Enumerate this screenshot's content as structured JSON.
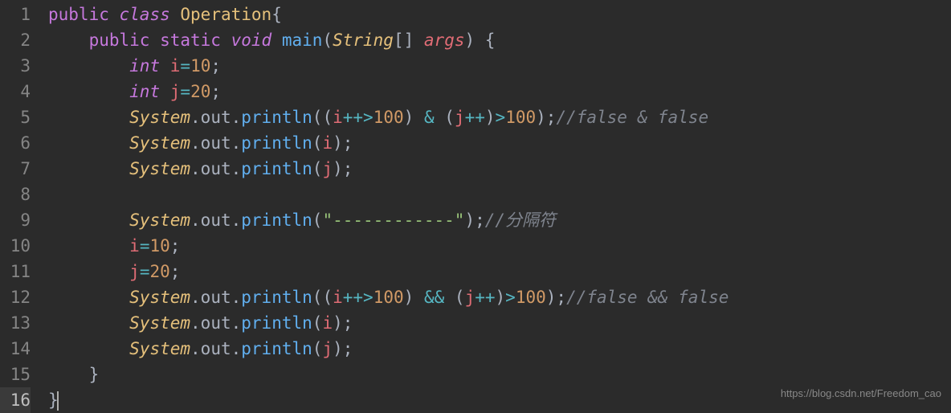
{
  "lineNumbers": [
    "1",
    "2",
    "3",
    "4",
    "5",
    "6",
    "7",
    "8",
    "9",
    "10",
    "11",
    "12",
    "13",
    "14",
    "15",
    "16"
  ],
  "activeLine": 16,
  "tokens": {
    "public": "public",
    "class": "class",
    "static": "static",
    "void": "void",
    "int": "int",
    "Operation": "Operation",
    "main": "main",
    "String": "String",
    "args": "args",
    "System": "System",
    "out": "out",
    "println": "println",
    "i": "i",
    "j": "j",
    "v10": "10",
    "v20": "20",
    "v100": "100",
    "amp": "&",
    "ampamp": "&&",
    "gt": ">",
    "plusplus": "++",
    "eq": "=",
    "semi": ";",
    "lb": "{",
    "rb": "}",
    "lp": "(",
    "rp": ")",
    "lbr": "[",
    "rbr": "]",
    "dot": ".",
    "sp": " ",
    "dashstr": "\"------------\"",
    "c1": "//false & false",
    "c2": "//分隔符",
    "c3": "//false && false"
  },
  "watermark": "https://blog.csdn.net/Freedom_cao",
  "chart_data": {
    "type": "table",
    "title": "Java source code",
    "language": "java",
    "lines": [
      "public class Operation{",
      "    public static void main(String[] args) {",
      "        int i=10;",
      "        int j=20;",
      "        System.out.println((i++>100) & (j++)>100);//false & false",
      "        System.out.println(i);",
      "        System.out.println(j);",
      "",
      "        System.out.println(\"------------\");//分隔符",
      "        i=10;",
      "        j=20;",
      "        System.out.println((i++>100) && (j++)>100);//false && false",
      "        System.out.println(i);",
      "        System.out.println(j);",
      "    }",
      "}"
    ]
  }
}
